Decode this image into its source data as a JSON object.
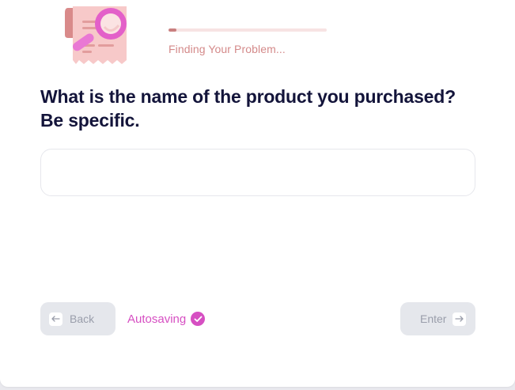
{
  "colors": {
    "accent_pink": "#d64fc2",
    "status_text": "#d48a8a",
    "progress_fill": "#c98080",
    "heading": "#13143a",
    "button_bg": "#e5e7ec",
    "button_text": "#9a9eab"
  },
  "header": {
    "illustration_icon": "receipt-magnifier-icon",
    "progress_fraction": 0.05,
    "status": "Finding Your Problem..."
  },
  "question": {
    "text": "What is the name of the product you purchased? Be specific."
  },
  "answer": {
    "value": "",
    "placeholder": ""
  },
  "footer": {
    "back_label": "Back",
    "back_icon": "arrow-left-icon",
    "autosave_label": "Autosaving",
    "autosave_icon": "check-circle-icon",
    "enter_label": "Enter",
    "enter_icon": "arrow-right-icon"
  }
}
